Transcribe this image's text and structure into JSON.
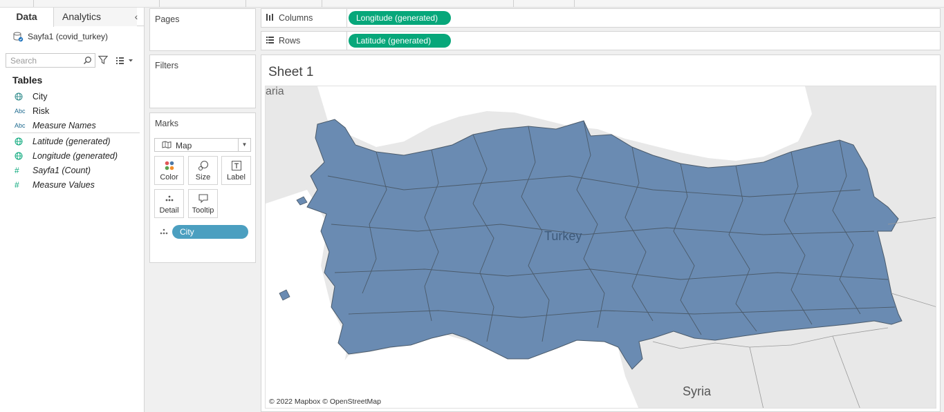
{
  "data_pane": {
    "tabs": {
      "data": "Data",
      "analytics": "Analytics"
    },
    "datasource": "Sayfa1 (covid_turkey)",
    "search": {
      "placeholder": "Search"
    },
    "tables_heading": "Tables",
    "fields": [
      {
        "type": "Geo",
        "name": "City",
        "italic": false,
        "icon": "globe-icon"
      },
      {
        "type": "Abc",
        "name": "Risk",
        "italic": false,
        "icon": "abc-icon"
      },
      {
        "type": "Abc",
        "name": "Measure Names",
        "italic": true,
        "icon": "abc-icon"
      },
      {
        "type": "Geo",
        "name": "Latitude (generated)",
        "italic": true,
        "icon": "globe-icon"
      },
      {
        "type": "Geo",
        "name": "Longitude (generated)",
        "italic": true,
        "icon": "globe-icon"
      },
      {
        "type": "#",
        "name": "Sayfa1 (Count)",
        "italic": true,
        "icon": "hash-icon"
      },
      {
        "type": "#",
        "name": "Measure Values",
        "italic": true,
        "icon": "hash-icon"
      }
    ]
  },
  "cards": {
    "pages": "Pages",
    "filters": "Filters",
    "marks": "Marks",
    "mark_type": "Map",
    "mark_buttons": [
      "Color",
      "Size",
      "Label",
      "Detail",
      "Tooltip"
    ],
    "detail_pill": "City"
  },
  "shelves": {
    "columns": {
      "label": "Columns",
      "pill": "Longitude (generated)"
    },
    "rows": {
      "label": "Rows",
      "pill": "Latitude (generated)"
    }
  },
  "sheet": {
    "title": "Sheet 1",
    "attribution": "© 2022 Mapbox © OpenStreetMap",
    "labels": {
      "turkey": "Turkey",
      "syria": "Syria",
      "bulgaria_partial": "aria"
    },
    "fill_color": "#6a8bb2",
    "border_color": "#4a5a6a",
    "sea_color": "#ffffff",
    "land_color": "#e8e8e8"
  }
}
